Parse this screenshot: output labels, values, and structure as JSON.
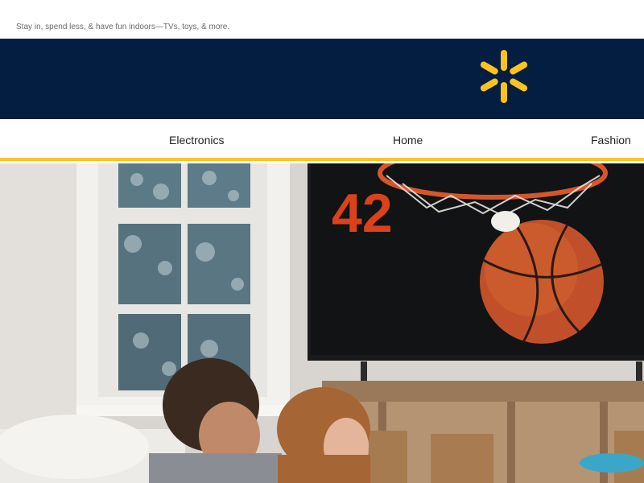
{
  "preheader": {
    "text": "Stay in, spend less, & have fun indoors—TVs, toys, & more."
  },
  "brand": {
    "logo_icon": "walmart-spark-icon",
    "colors": {
      "navy": "#041e42",
      "yellow": "#f8c22a"
    }
  },
  "nav": {
    "items": [
      {
        "label": "Electronics"
      },
      {
        "label": "Home"
      },
      {
        "label": "Fashion"
      }
    ]
  },
  "hero": {
    "scoreboard": "42"
  }
}
